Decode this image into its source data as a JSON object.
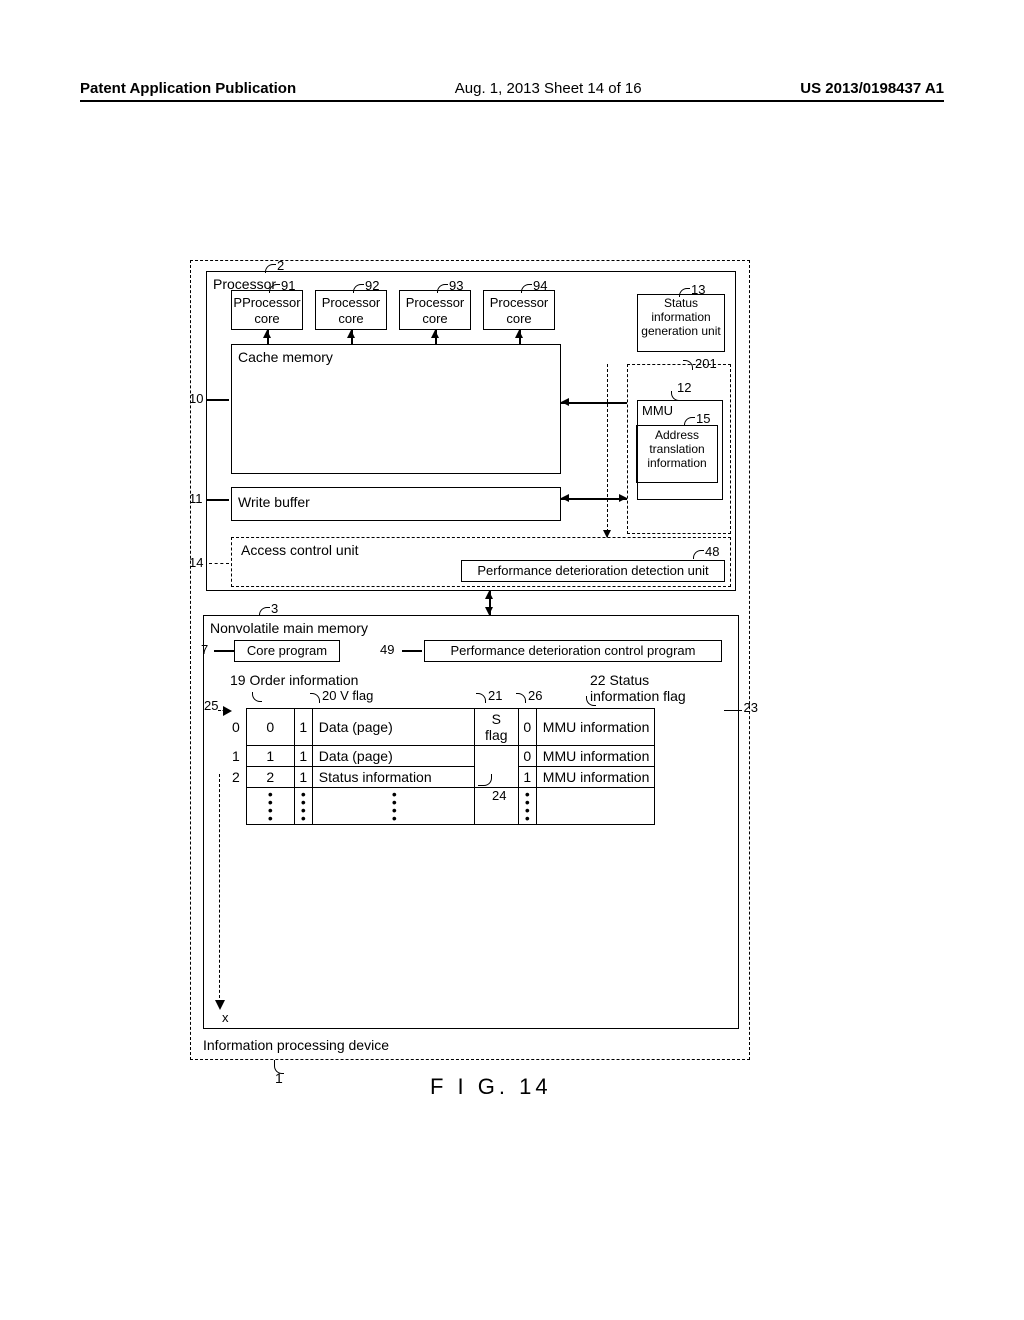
{
  "header": {
    "left": "Patent Application Publication",
    "center": "Aug. 1, 2013  Sheet 14 of 16",
    "right": "US 2013/0198437 A1"
  },
  "device_label": "Information processing device",
  "figure_caption": "F I G. 14",
  "refs": {
    "r1": "1",
    "r2": "2",
    "r3": "3",
    "r7": "7",
    "r10": "10",
    "r11": "11",
    "r12": "12",
    "r13": "13",
    "r14": "14",
    "r15": "15",
    "r19": "19 Order information",
    "r20": "20 V flag",
    "r21": "21",
    "r22": "22 Status",
    "r22b": "information flag",
    "r23": "23",
    "r24": "24",
    "r25": "25",
    "r26": "26",
    "r48": "48",
    "r49": "49",
    "r91": "91",
    "r92": "92",
    "r93": "93",
    "r94": "94",
    "r201": "201"
  },
  "processor": {
    "label": "Processor",
    "core_label": "Processor core",
    "cache": "Cache memory",
    "write_buffer": "Write buffer",
    "status_gen": "Status information generation unit",
    "mmu": "MMU",
    "addr_trans": "Address translation information",
    "acu": "Access control unit",
    "pd_detect": "Performance deterioration detection unit"
  },
  "nvmm": {
    "label": "Nonvolatile main memory",
    "core_program": "Core program",
    "pd_ctrl": "Performance deterioration control program",
    "table": {
      "rows": [
        {
          "idx": "0",
          "order": "0",
          "v": "1",
          "data": "Data (page)",
          "s": "S flag",
          "sf": "0",
          "mmu": "MMU information"
        },
        {
          "idx": "1",
          "order": "1",
          "v": "1",
          "data": "Data (page)",
          "s": "",
          "sf": "0",
          "mmu": "MMU information"
        },
        {
          "idx": "2",
          "order": "2",
          "v": "1",
          "data": "Status information",
          "s": "",
          "sf": "1",
          "mmu": "MMU information"
        }
      ],
      "tail_x": "x"
    }
  }
}
